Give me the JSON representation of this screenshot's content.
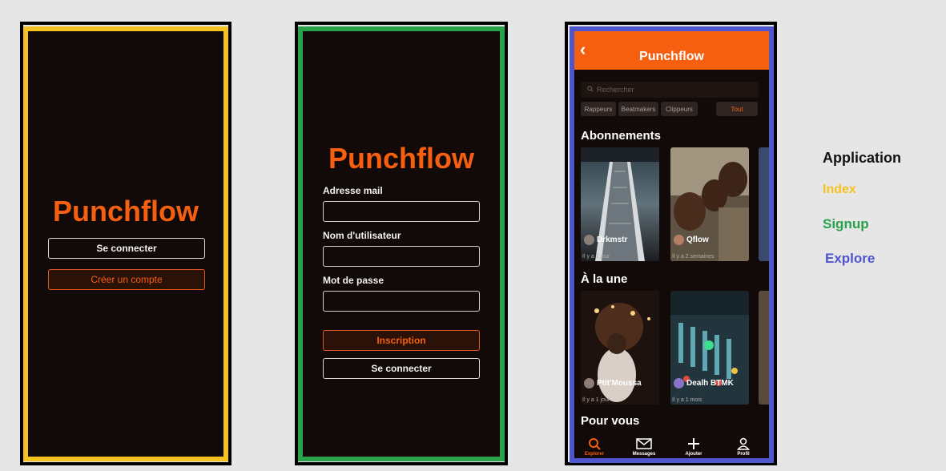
{
  "index": {
    "title": "Punchflow",
    "login_button": "Se connecter",
    "create_account_button": "Créer un compte"
  },
  "signup": {
    "title": "Punchflow",
    "email_label": "Adresse mail",
    "username_label": "Nom d'utilisateur",
    "password_label": "Mot de passe",
    "register_button": "Inscription",
    "login_button": "Se connecter"
  },
  "explore": {
    "back_icon": "chevron-left-icon",
    "title": "Punchflow",
    "search_placeholder": "Rechercher",
    "filters": [
      "Rappeurs",
      "Beatmakers",
      "Clippeurs",
      "Tout"
    ],
    "active_filter": "Tout",
    "subscriptions": {
      "title": "Abonnements",
      "cards": [
        {
          "name": "Drkmstr",
          "time": "Il y a 1 jour"
        },
        {
          "name": "Qflow",
          "time": "Il y a 2 semaines"
        }
      ]
    },
    "featured": {
      "title": "À la une",
      "cards": [
        {
          "name": "Ptit'Moussa",
          "time": "Il y a 1 jour"
        },
        {
          "name": "Dealh BTMK",
          "time": "Il y a 1 mois"
        }
      ]
    },
    "for_you": {
      "title": "Pour vous"
    },
    "tabs": [
      {
        "label": "Explorer",
        "icon": "search-icon"
      },
      {
        "label": "Messages",
        "icon": "envelope-icon"
      },
      {
        "label": "Ajouter",
        "icon": "plus-icon"
      },
      {
        "label": "Profil",
        "icon": "user-icon"
      }
    ]
  },
  "legend": {
    "application": "Application",
    "index": "Index",
    "signup": "Signup",
    "explore": "Explore"
  },
  "colors": {
    "brand": "#f55f0f",
    "index_border": "#f6c220",
    "signup_border": "#29a24b",
    "explore_border": "#4f55cc",
    "screen_bg": "#120a08"
  }
}
